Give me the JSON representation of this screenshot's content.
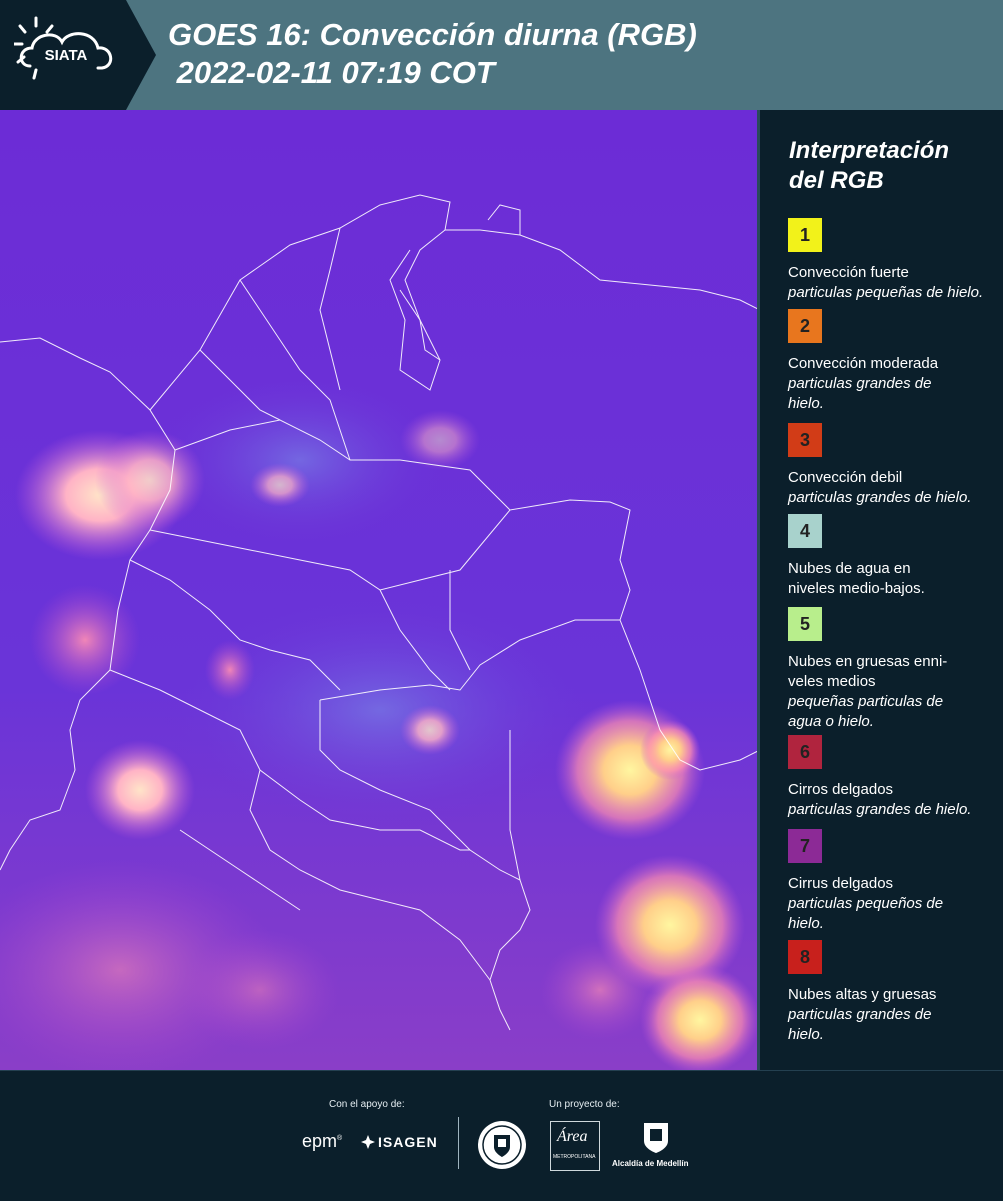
{
  "header": {
    "logo_text": "SIATA",
    "title_line1": "GOES 16: Convección diurna (RGB)",
    "title_line2": " 2022-02-11 07:19 COT"
  },
  "legend": {
    "title": "Interpretación del RGB",
    "items": [
      {
        "number": "1",
        "color": "#f2f21a",
        "label": "Convección fuerte",
        "desc": "particulas pequeñas de hielo."
      },
      {
        "number": "2",
        "color": "#e8761e",
        "label": "Convección moderada",
        "desc": "particulas grandes de hielo."
      },
      {
        "number": "3",
        "color": "#d23c17",
        "label": "Convección debil",
        "desc": "particulas grandes de hielo."
      },
      {
        "number": "4",
        "color": "#a8d2cc",
        "label": "Nubes de agua en niveles medio-bajos.",
        "desc": ""
      },
      {
        "number": "5",
        "color": "#b8ee8c",
        "label": "Nubes en gruesas enni-veles medios",
        "desc": "pequeñas particulas de agua o hielo."
      },
      {
        "number": "6",
        "color": "#b0243e",
        "label": "Cirros delgados",
        "desc": "particulas grandes de hielo."
      },
      {
        "number": "7",
        "color": "#8c2a96",
        "label": "Cirrus delgados",
        "desc": "particulas pequeños de hielo."
      },
      {
        "number": "8",
        "color": "#c8201c",
        "label": "Nubes altas y gruesas",
        "desc": "particulas grandes de hielo."
      }
    ]
  },
  "footer": {
    "support_label": "Con el apoyo de:",
    "project_label": "Un proyecto de:",
    "brand_epm": "epm",
    "brand_isagen": "ISAGEN",
    "brand_area": "Área",
    "brand_area_sub": "METROPOLITANA",
    "brand_alcaldia": "Alcaldía de Medellín"
  },
  "colors": {
    "background": "#0b1f2b",
    "header": "#4d7480",
    "map_base": "#6a2fd8"
  }
}
